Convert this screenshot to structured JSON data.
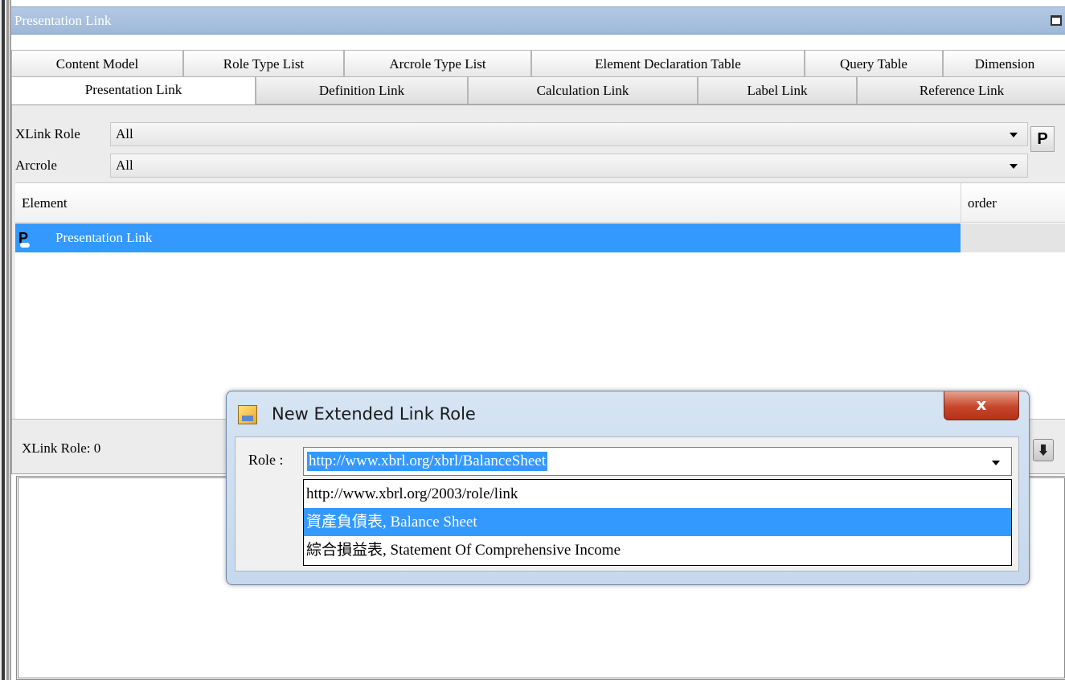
{
  "panel": {
    "title": "Presentation Link"
  },
  "tabs_row1": [
    {
      "label": "Content Model"
    },
    {
      "label": "Role Type List"
    },
    {
      "label": "Arcrole Type List"
    },
    {
      "label": "Element Declaration Table"
    },
    {
      "label": "Query Table"
    },
    {
      "label": "Dimension"
    }
  ],
  "tabs_row2": [
    {
      "label": "Presentation Link",
      "active": true
    },
    {
      "label": "Definition Link"
    },
    {
      "label": "Calculation Link"
    },
    {
      "label": "Label Link"
    },
    {
      "label": "Reference Link"
    }
  ],
  "filters": {
    "xlink_role_label": "XLink Role",
    "xlink_role_value": "All",
    "arcrole_label": "Arcrole",
    "arcrole_value": "All",
    "p_button_label": "P"
  },
  "table": {
    "columns": [
      "Element",
      "order"
    ],
    "rows": [
      {
        "element": "Presentation Link",
        "order": "",
        "selected": true
      }
    ]
  },
  "status": {
    "text": "XLink Role: 0"
  },
  "dialog": {
    "title": "New Extended Link Role",
    "close_label": "x",
    "role_label": "Role :",
    "role_value": "http://www.xbrl.org/xbrl/BalanceSheet",
    "options": [
      {
        "label": "http://www.xbrl.org/2003/role/link",
        "selected": false
      },
      {
        "label": "資產負債表, Balance Sheet",
        "selected": true
      },
      {
        "label": "綜合損益表, Statement Of Comprehensive Income",
        "selected": false
      }
    ]
  },
  "colors": {
    "titlebar": "#9fb8d8",
    "selection": "#3399ff",
    "close_button": "#c7472b"
  }
}
